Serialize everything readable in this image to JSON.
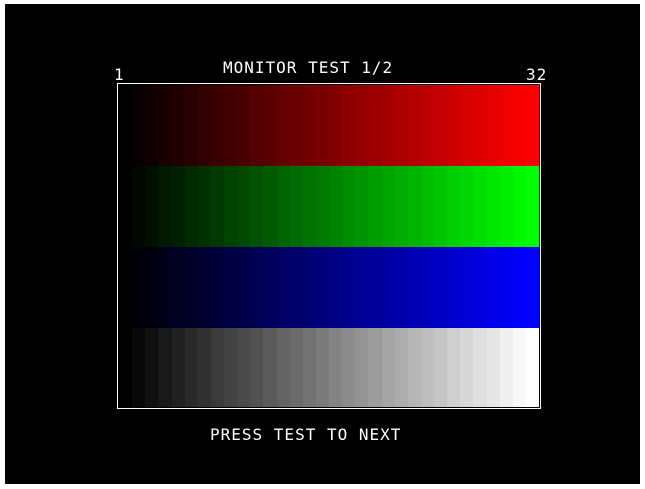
{
  "screen": {
    "title": "MONITOR TEST 1/2",
    "scale_start_label": "1",
    "scale_end_label": "32",
    "prompt": "PRESS TEST TO NEXT"
  },
  "bars": [
    {
      "name": "red",
      "color": "#ff0000"
    },
    {
      "name": "green",
      "color": "#00ff00"
    },
    {
      "name": "blue",
      "color": "#0000ff"
    },
    {
      "name": "white",
      "color": "#ffffff"
    }
  ],
  "steps": 32
}
